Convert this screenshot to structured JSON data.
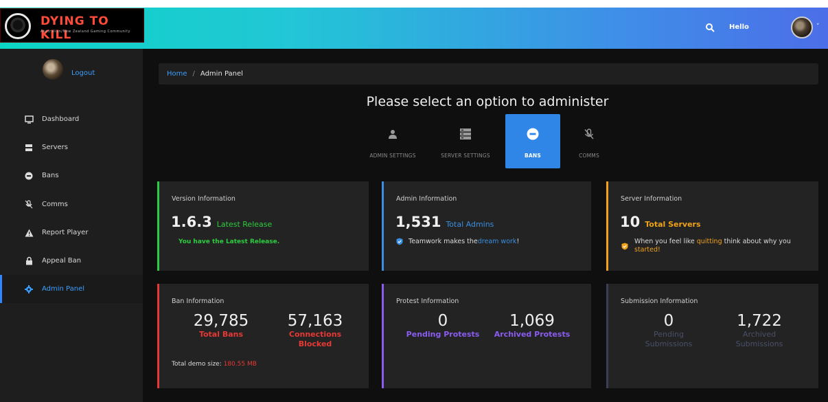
{
  "header": {
    "logo_title": "DYING TO KILL",
    "logo_subtitle": "Australian/New Zealand Gaming Community",
    "hello": "Hello",
    "search_icon": "search-icon",
    "accent": "#3f8ee8"
  },
  "sidebar": {
    "logout": "Logout",
    "items": [
      {
        "label": "Dashboard",
        "icon": "monitor-icon"
      },
      {
        "label": "Servers",
        "icon": "server-icon"
      },
      {
        "label": "Bans",
        "icon": "ban-icon"
      },
      {
        "label": "Comms",
        "icon": "mic-off-icon"
      },
      {
        "label": "Report Player",
        "icon": "warning-icon"
      },
      {
        "label": "Appeal Ban",
        "icon": "lock-icon"
      },
      {
        "label": "Admin Panel",
        "icon": "gear-icon"
      }
    ]
  },
  "breadcrumb": {
    "home": "Home",
    "separator": "/",
    "current": "Admin Panel"
  },
  "page": {
    "title": "Please select an option to administer"
  },
  "options": [
    {
      "label": "ADMIN SETTINGS",
      "icon": "user-icon"
    },
    {
      "label": "SERVER SETTINGS",
      "icon": "server-icon"
    },
    {
      "label": "BANS",
      "icon": "ban-icon"
    },
    {
      "label": "COMMS",
      "icon": "mic-off-icon"
    }
  ],
  "cards": {
    "version": {
      "title": "Version Information",
      "value": "1.6.3",
      "suffix": "Latest Release",
      "message": "You have the Latest Release.",
      "color": "#2ecc40"
    },
    "admin": {
      "title": "Admin Information",
      "value": "1,531",
      "suffix": "Total Admins",
      "msg_before": "Teamwork makes the ",
      "msg_link": "dream work",
      "msg_after": "!",
      "color": "#3a8fe0"
    },
    "server": {
      "title": "Server Information",
      "value": "10",
      "suffix": "Total Servers",
      "msg_before": "When you feel like ",
      "msg_link": "quitting",
      "msg_mid": " think about why you",
      "msg_end": "started!",
      "color": "#f0a21a"
    },
    "ban": {
      "title": "Ban Information",
      "total_bans": "29,785",
      "total_bans_label": "Total Bans",
      "blocked": "57,163",
      "blocked_label_1": "Connections",
      "blocked_label_2": "Blocked",
      "demo_label": "Total demo size: ",
      "demo_size": "180.55 MB",
      "color": "#e53935"
    },
    "protest": {
      "title": "Protest Information",
      "pending": "0",
      "pending_label": "Pending Protests",
      "archived": "1,069",
      "archived_label": "Archived Protests",
      "color": "#8a5cf0"
    },
    "submission": {
      "title": "Submission Information",
      "pending": "0",
      "pending_label_1": "Pending",
      "pending_label_2": "Submissions",
      "archived": "1,722",
      "archived_label_1": "Archived",
      "archived_label_2": "Submissions",
      "color": "#3b3f55"
    }
  }
}
